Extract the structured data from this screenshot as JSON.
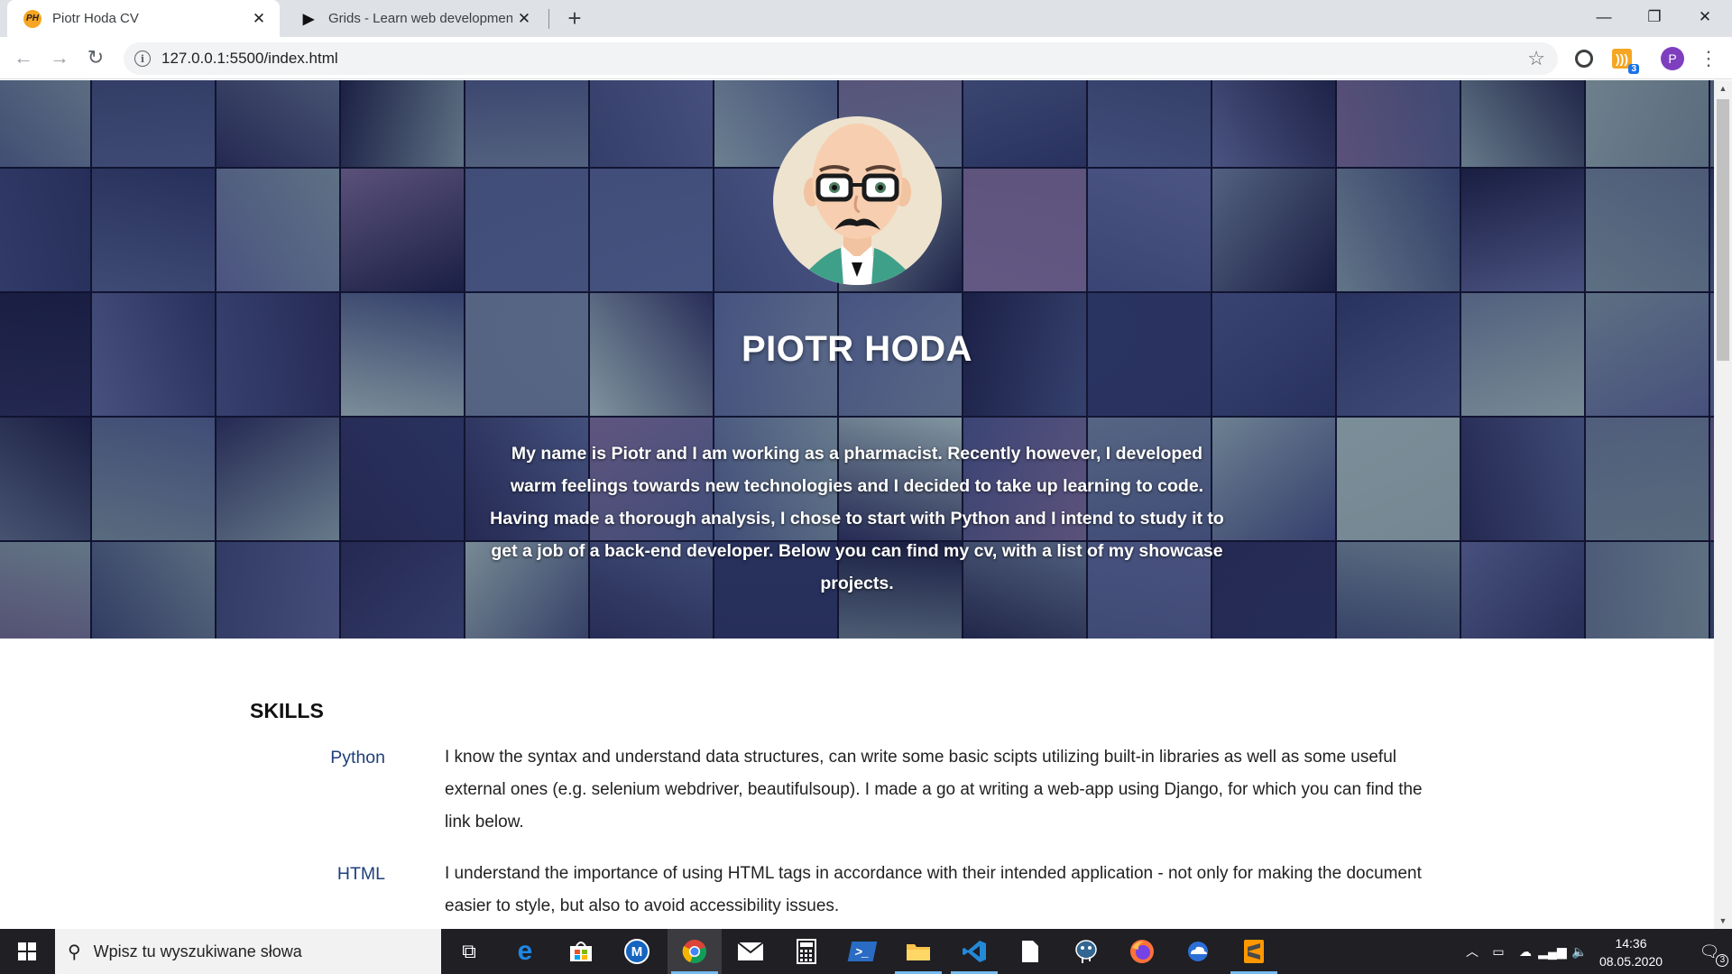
{
  "browser": {
    "tabs": [
      {
        "favicon": "PH",
        "title": "Piotr Hoda CV",
        "active": true
      },
      {
        "favicon": "▶",
        "title": "Grids - Learn web development |",
        "active": false
      }
    ],
    "new_tab_icon": "+",
    "window_controls": {
      "minimize": "—",
      "restore": "❐",
      "close": "✕"
    },
    "nav": {
      "back": "←",
      "forward": "→",
      "reload": "↻"
    },
    "address": "127.0.0.1:5500/index.html",
    "bookmark_icon": "☆",
    "extension_badge": "3",
    "profile_initial": "P",
    "menu_icon": "⋮"
  },
  "hero": {
    "name": "PIOTR HODA",
    "bio": "My name is Piotr and I am working as a pharmacist. Recently however, I developed warm feelings towards new technologies and I decided to take up learning to code. Having made a thorough analysis, I chose to start with Python and I intend to study it to get a job of a back-end developer. Below you can find my cv, with a list of my showcase projects."
  },
  "skills": {
    "heading": "SKILLS",
    "items": [
      {
        "name": "Python",
        "description": "I know the syntax and understand data structures, can write some basic scipts utilizing built-in libraries as well as some useful external ones (e.g. selenium webdriver, beautifulsoup). I made a go at writing a web-app using Django, for which you can find the link below."
      },
      {
        "name": "HTML",
        "description": "I understand the importance of using HTML tags in accordance with their intended application - not only for making the document easier to style, but also to avoid accessibility issues."
      }
    ]
  },
  "taskbar": {
    "search_placeholder": "Wpisz tu wyszukiwane słowa",
    "time": "14:36",
    "date": "08.05.2020",
    "notification_count": "3"
  },
  "colors": {
    "tabstrip": "#dee1e6",
    "skill_name": "#1f3f7a",
    "taskbar": "#1f1f24",
    "profile": "#7e3fbf"
  }
}
